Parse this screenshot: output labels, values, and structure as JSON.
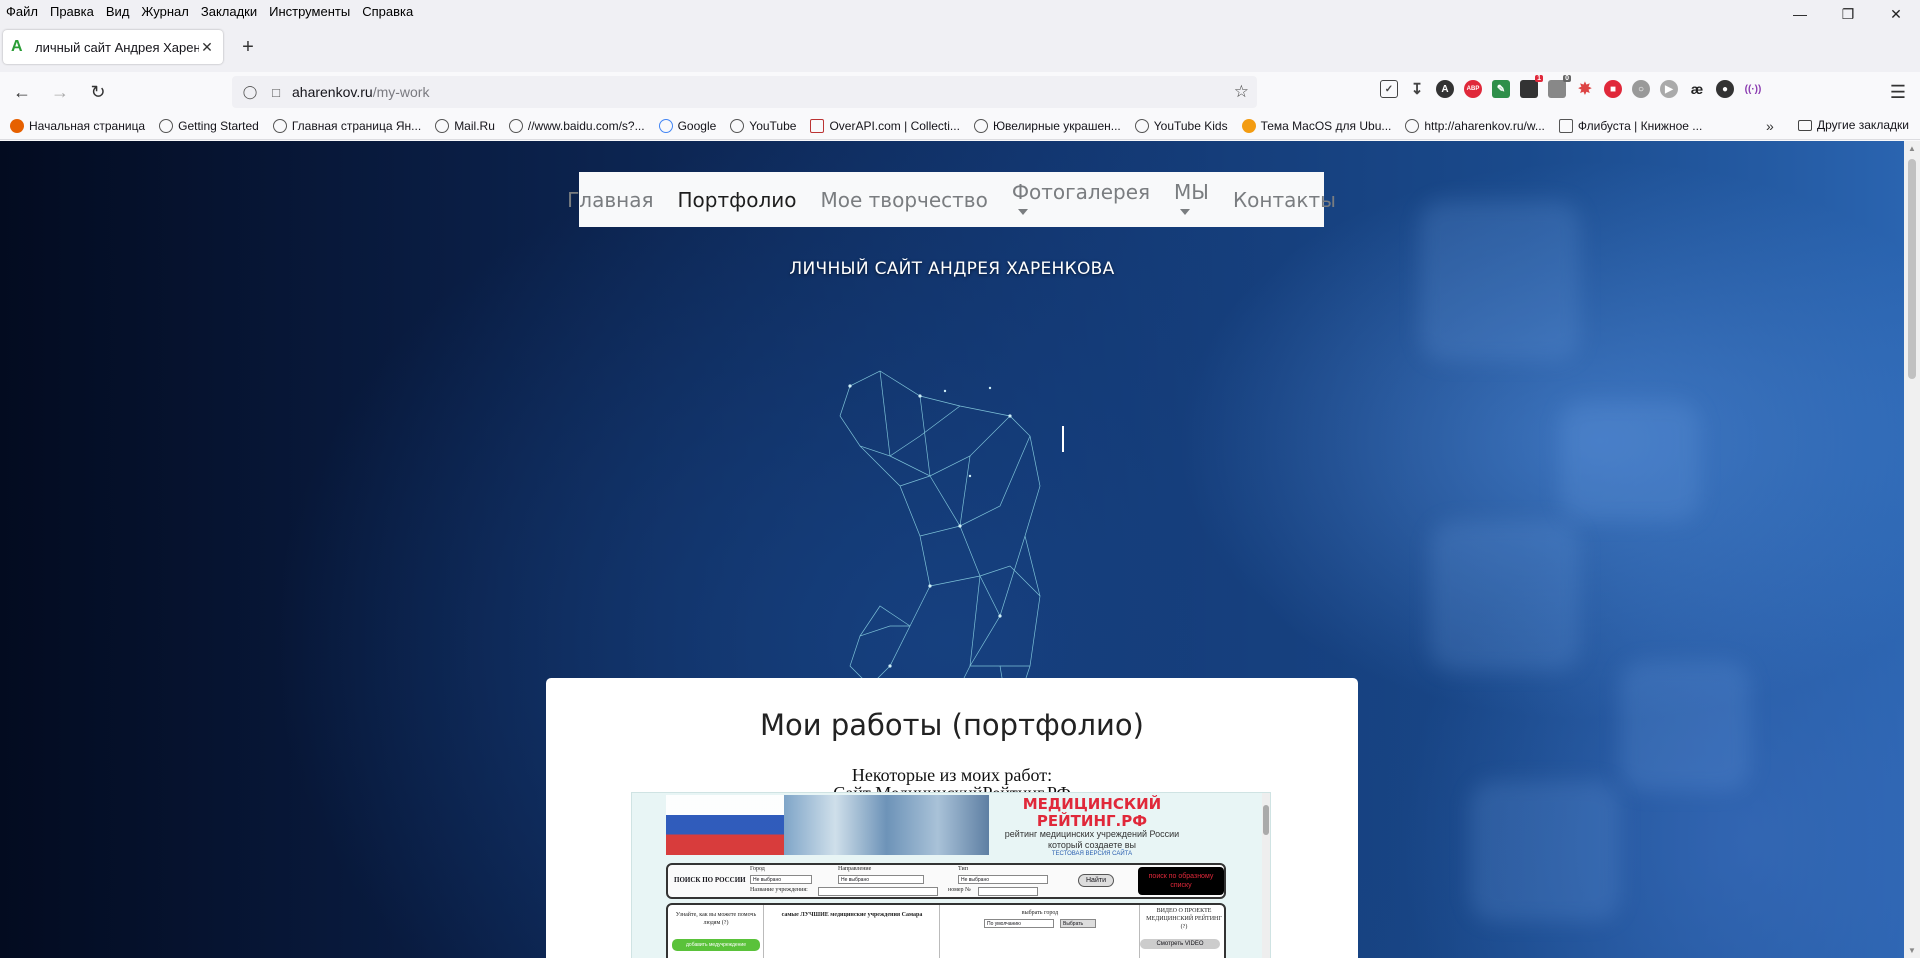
{
  "menu": [
    "Файл",
    "Правка",
    "Вид",
    "Журнал",
    "Закладки",
    "Инструменты",
    "Справка"
  ],
  "tab": {
    "title": "личный сайт Андрея Харенков"
  },
  "url": {
    "host": "aharenkov.ru",
    "path": "/my-work"
  },
  "bookmarks": [
    "Начальная страница",
    "Getting Started",
    "Главная страница Ян...",
    "Mail.Ru",
    "//www.baidu.com/s?...",
    "Google",
    "YouTube",
    "OverAPI.com | Collecti...",
    "Ювелирные украшен...",
    "YouTube Kids",
    "Тема MacOS для Ubu...",
    "http://aharenkov.ru/w...",
    "Флибуста | Книжное ..."
  ],
  "other_bookmarks": "Другие закладки",
  "toolbar_badges": {
    "ext_red_count": "1",
    "ext_gray_count": "0",
    "abp": "ABP",
    "ae": "æ"
  },
  "site": {
    "nav": [
      "Главная",
      "Портфолио",
      "Мое творчество",
      "Фотогалерея",
      "МЫ",
      "Контакты"
    ],
    "active_nav": "Портфолио",
    "title": "ЛИЧНЫЙ САЙТ АНДРЕЯ ХАРЕНКОВА",
    "heading": "Мои работы (портфолио)",
    "intro": "Некоторые из моих работ:",
    "work_title": "Сайт МедицинскийРейтинг.РФ"
  },
  "screenshot": {
    "logo_line1": "МЕДИЦИНСКИЙ",
    "logo_line2": "РЕЙТИНГ.РФ",
    "tagline": "рейтинг медицинских учреждений России который создаете вы",
    "test_note": "ТЕСТОВАЯ ВЕРСИЯ САЙТА",
    "search_title": "ПОИСК ПО РОССИИ",
    "city_label": "Город",
    "direction_label": "Направление",
    "type_label": "Тип",
    "not_selected": "Не выбрано",
    "institution_label": "Название учреждения:",
    "number_label": "номер №",
    "find_button": "Найти",
    "black_box": "поиск по образному списку",
    "help_text": "Узнайте, как вы можете помочь людям (?)",
    "green_button": "добавить медучреждение",
    "best_text": "самые ЛУЧШИЕ медицинские учреждения Самара",
    "choose_city": "выбрать город",
    "default_option": "По умолчанию",
    "choose_button": "Выбрать",
    "video_text": "ВИДЕО О ПРОЕКТЕ МЕДИЦИНСКИЙ РЕЙТИНГ (?)",
    "watch_video": "Смотреть VIDEO"
  }
}
